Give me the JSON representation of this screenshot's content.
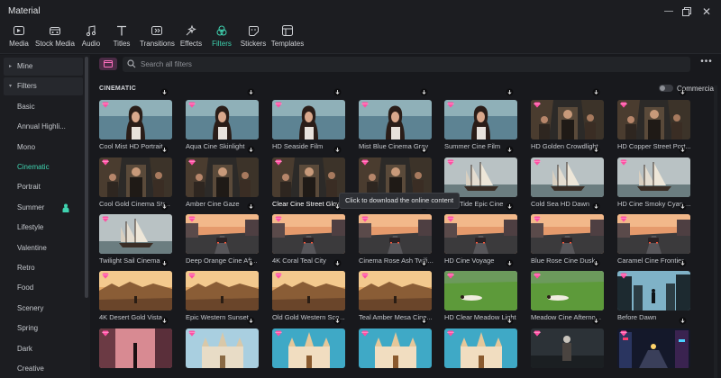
{
  "window": {
    "title": "Material"
  },
  "toolbar": {
    "items": [
      {
        "label": "Media",
        "icon": "media-icon"
      },
      {
        "label": "Stock Media",
        "icon": "stock-media-icon"
      },
      {
        "label": "Audio",
        "icon": "audio-icon"
      },
      {
        "label": "Titles",
        "icon": "titles-icon"
      },
      {
        "label": "Transitions",
        "icon": "transitions-icon"
      },
      {
        "label": "Effects",
        "icon": "effects-icon"
      },
      {
        "label": "Filters",
        "icon": "filters-icon",
        "active": true
      },
      {
        "label": "Stickers",
        "icon": "stickers-icon"
      },
      {
        "label": "Templates",
        "icon": "templates-icon"
      }
    ],
    "accent": "#3fd3b0"
  },
  "sidebar": {
    "items": [
      {
        "label": "Mine",
        "type": "head",
        "caret": "▸"
      },
      {
        "label": "Filters",
        "type": "head",
        "caret": "▾"
      },
      {
        "label": "Basic"
      },
      {
        "label": "Annual Highli..."
      },
      {
        "label": "Mono"
      },
      {
        "label": "Cinematic",
        "selected": true
      },
      {
        "label": "Portrait"
      },
      {
        "label": "Summer",
        "badge": "person-icon"
      },
      {
        "label": "Lifestyle"
      },
      {
        "label": "Valentine"
      },
      {
        "label": "Retro"
      },
      {
        "label": "Food"
      },
      {
        "label": "Scenery"
      },
      {
        "label": "Spring"
      },
      {
        "label": "Dark"
      },
      {
        "label": "Creative"
      }
    ]
  },
  "search": {
    "placeholder": "Search all filters"
  },
  "section": {
    "title": "CINEMATIC",
    "toggle_label": "Commercial"
  },
  "tooltip": {
    "text": "Click to download the online content"
  },
  "cards": [
    {
      "label": "Cool Mist HD Portrait",
      "scene": "portrait"
    },
    {
      "label": "Aqua Cine Skinlight",
      "scene": "portrait"
    },
    {
      "label": "HD Seaside Film",
      "scene": "portrait"
    },
    {
      "label": "Mist Blue Cinema Gray",
      "scene": "portrait"
    },
    {
      "label": "Summer Cine Film",
      "scene": "portrait"
    },
    {
      "label": "HD Golden Crowdlight",
      "scene": "street"
    },
    {
      "label": "HD Copper Street Port...",
      "scene": "street"
    },
    {
      "label": "Cool Gold Cinema Str...",
      "scene": "street"
    },
    {
      "label": "Amber Cine Gaze",
      "scene": "street"
    },
    {
      "label": "Clear Cine Street Glow",
      "scene": "street",
      "highlight": true
    },
    {
      "label": "",
      "scene": "street"
    },
    {
      "label": "Blue Tide Epic Cine",
      "scene": "ship"
    },
    {
      "label": "Cold Sea HD Dawn",
      "scene": "ship"
    },
    {
      "label": "HD Cine Smoky Cyan ...",
      "scene": "ship"
    },
    {
      "label": "Twilight Sail Cinema",
      "scene": "ship"
    },
    {
      "label": "Deep Orange Cine Aft...",
      "scene": "road"
    },
    {
      "label": "4K Coral Teal City",
      "scene": "road"
    },
    {
      "label": "Cinema Rose Ash Twili...",
      "scene": "road"
    },
    {
      "label": "HD Cine Voyage",
      "scene": "road"
    },
    {
      "label": "Blue Rose Cine Dusk",
      "scene": "road"
    },
    {
      "label": "Caramel Cine Frontier",
      "scene": "road"
    },
    {
      "label": "4K Desert Gold Vista",
      "scene": "desert"
    },
    {
      "label": "Epic Western Sunset",
      "scene": "desert"
    },
    {
      "label": "Old Gold Western Sco...",
      "scene": "desert"
    },
    {
      "label": "Teal Amber Mesa Cine...",
      "scene": "desert"
    },
    {
      "label": "HD Clear Meadow Light",
      "scene": "meadow"
    },
    {
      "label": "Meadow Cine Afterno...",
      "scene": "meadow"
    },
    {
      "label": "Before Dawn",
      "scene": "city"
    },
    {
      "label": "",
      "scene": "pink"
    },
    {
      "label": "",
      "scene": "church"
    },
    {
      "label": "",
      "scene": "church2"
    },
    {
      "label": "",
      "scene": "church2"
    },
    {
      "label": "",
      "scene": "church2"
    },
    {
      "label": "",
      "scene": "figure"
    },
    {
      "label": "",
      "scene": "neon"
    }
  ],
  "colors": {
    "background": "#18191d",
    "panel": "#1c1d21",
    "gem": "#ff4fa3"
  }
}
